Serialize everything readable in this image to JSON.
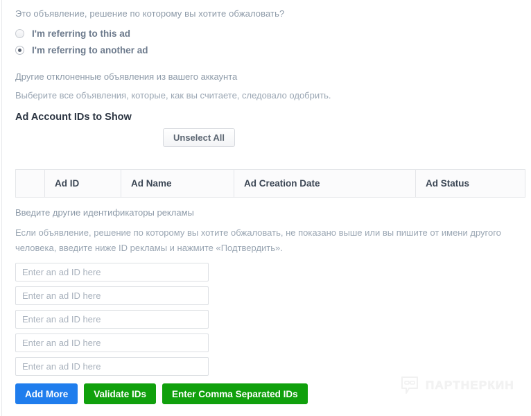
{
  "question": {
    "text": "Это объявление, решение по которому вы хотите обжаловать?"
  },
  "radios": [
    {
      "label": "I'm referring to this ad",
      "checked": false
    },
    {
      "label": "I'm referring to another ad",
      "checked": true
    }
  ],
  "sections": {
    "other_rejected_heading": "Другие отклоненные объявления из вашего аккаунта",
    "select_hint": "Выберите все объявления, которые, как вы считаете, следовало одобрить.",
    "ad_account_heading": "Ad Account IDs to Show",
    "enter_other_ids_heading": "Введите другие идентификаторы рекламы",
    "enter_other_ids_paragraph": "Если объявление, решение по которому вы хотите обжаловать, не показано выше или вы пишите от имени другого человека, введите ниже ID рекламы и нажмите «Подтвердить»."
  },
  "buttons": {
    "unselect_all": "Unselect All",
    "add_more": "Add More",
    "validate_ids": "Validate IDs",
    "enter_comma_separated_ids": "Enter Comma Separated IDs"
  },
  "table": {
    "columns": [
      "",
      "Ad ID",
      "Ad Name",
      "Ad Creation Date",
      "Ad Status"
    ],
    "rows": []
  },
  "ad_id_inputs": [
    {
      "value": "",
      "placeholder": "Enter an ad ID here"
    },
    {
      "value": "",
      "placeholder": "Enter an ad ID here"
    },
    {
      "value": "",
      "placeholder": "Enter an ad ID here"
    },
    {
      "value": "",
      "placeholder": "Enter an ad ID here"
    },
    {
      "value": "",
      "placeholder": "Enter an ad ID here"
    }
  ],
  "watermark": {
    "text": "ПАРТНЕРКИН"
  },
  "colors": {
    "primary_blue": "#1f7ded",
    "primary_green": "#10a00c",
    "muted_text": "#9aa6b3",
    "heading_text": "#2c3542",
    "border": "#dcdfe3"
  }
}
